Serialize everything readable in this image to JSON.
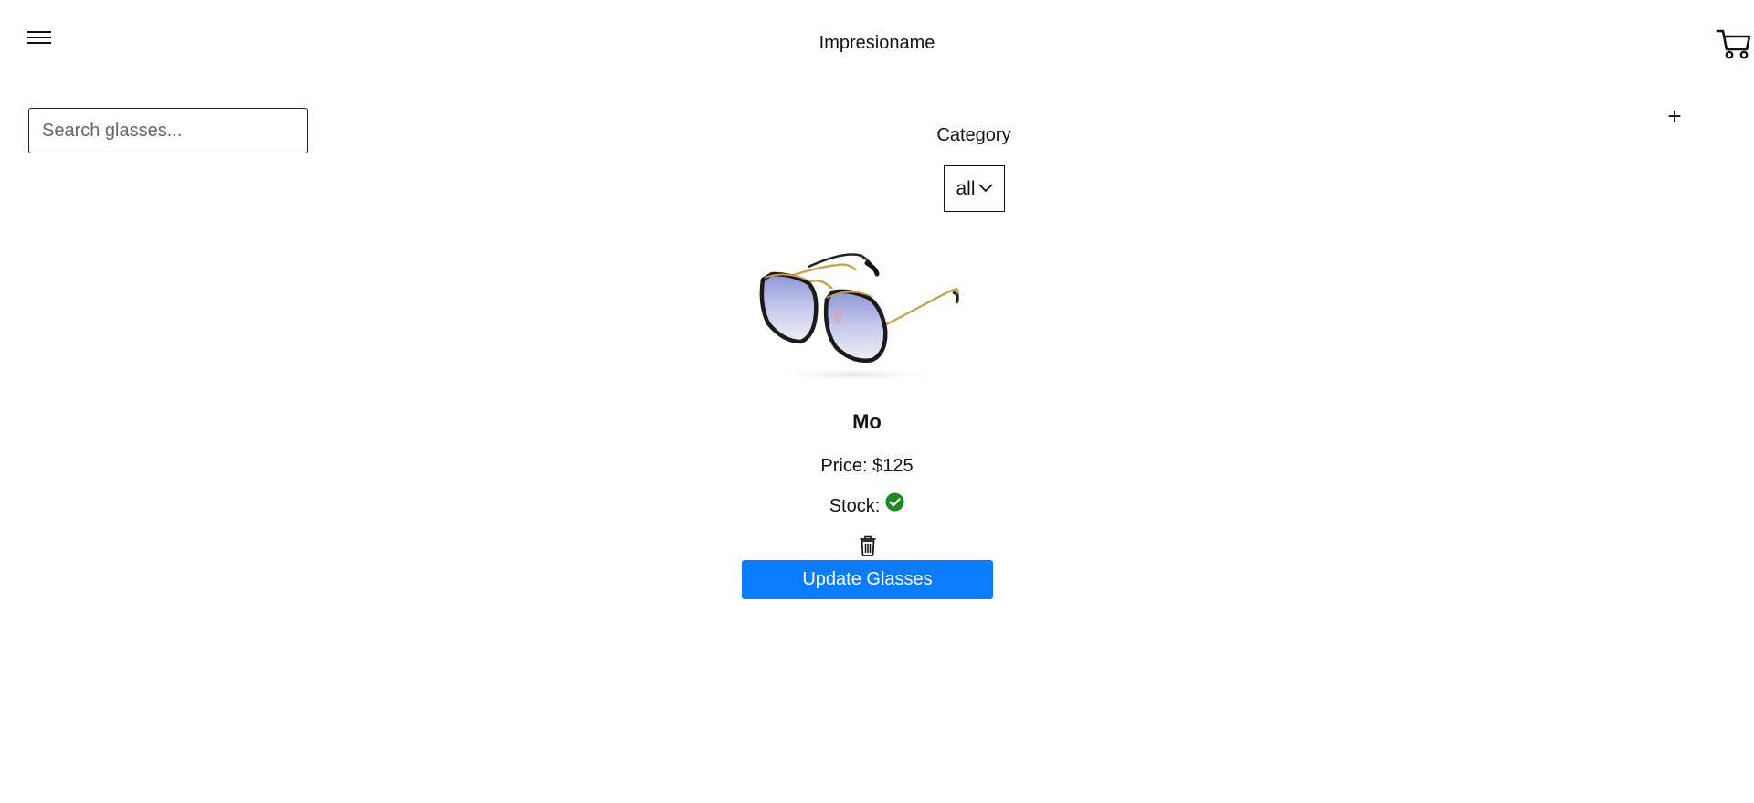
{
  "header": {
    "menu_icon": "hamburger-menu-icon",
    "brand": "Impresioname",
    "cart_icon": "shopping-cart-icon"
  },
  "search": {
    "placeholder": "Search glasses...",
    "value": ""
  },
  "toolbar": {
    "add_label": "+"
  },
  "filter": {
    "category_label": "Category",
    "selected": "all",
    "chevron_icon": "chevron-down-icon"
  },
  "product": {
    "image_icon": "sunglasses-image",
    "name": "Mo",
    "price_label": "Price: $125",
    "stock_label": "Stock:",
    "in_stock": true,
    "stock_icon": "check-circle-icon",
    "delete_icon": "trash-icon",
    "update_label": "Update Glasses"
  },
  "colors": {
    "primary_button": "#0a7cff",
    "in_stock": "#1a8a22"
  }
}
